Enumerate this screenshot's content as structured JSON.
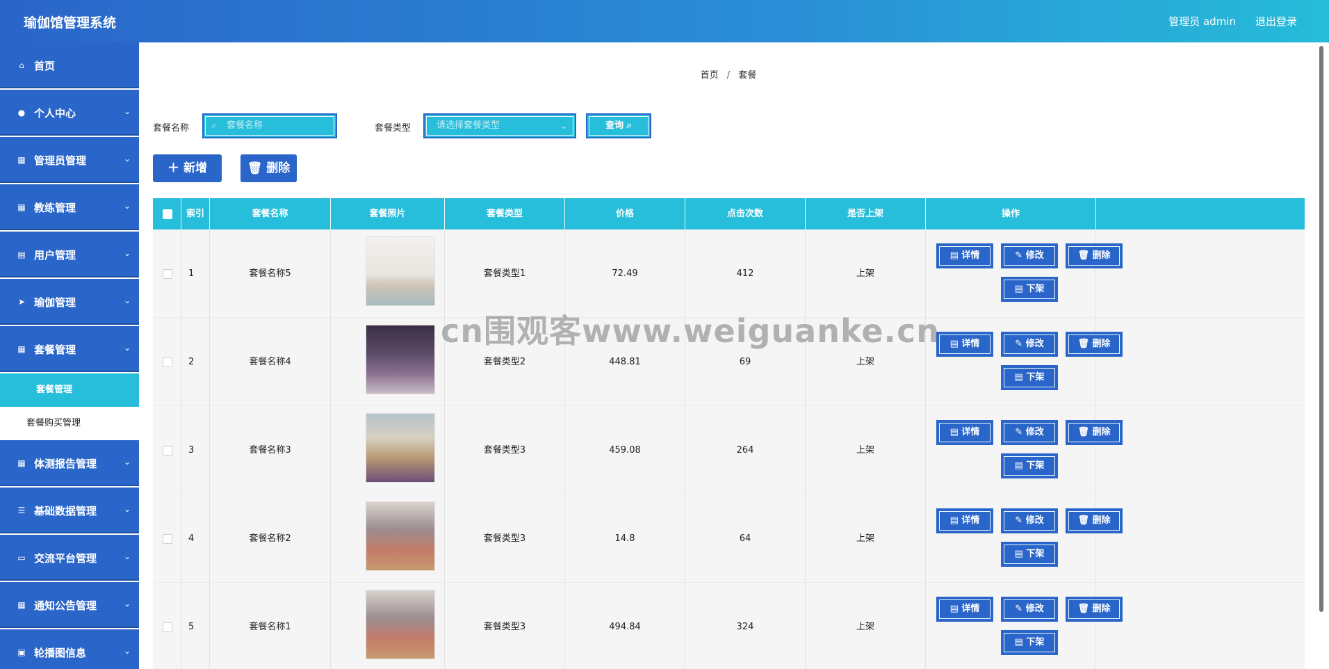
{
  "header": {
    "title": "瑜伽馆管理系统",
    "user": "管理员 admin",
    "logout": "退出登录"
  },
  "sidebar": {
    "items": [
      {
        "label": "首页",
        "icon": "home-icon",
        "glyph": "⌂",
        "arrow": ""
      },
      {
        "label": "个人中心",
        "icon": "user-icon",
        "glyph": "●",
        "arrow": "⌄"
      },
      {
        "label": "管理员管理",
        "icon": "grid-icon",
        "glyph": "▦",
        "arrow": "⌄"
      },
      {
        "label": "教练管理",
        "icon": "grid-icon",
        "glyph": "▦",
        "arrow": "⌄"
      },
      {
        "label": "用户管理",
        "icon": "document-icon",
        "glyph": "▤",
        "arrow": "⌄"
      },
      {
        "label": "瑜伽管理",
        "icon": "send-icon",
        "glyph": "➤",
        "arrow": "⌄"
      },
      {
        "label": "套餐管理",
        "icon": "grid-icon",
        "glyph": "▦",
        "arrow": "⌄"
      }
    ],
    "sub_items": [
      {
        "label": "套餐管理"
      },
      {
        "label": "套餐购买管理"
      }
    ],
    "items_after": [
      {
        "label": "体测报告管理",
        "icon": "grid-icon",
        "glyph": "▦",
        "arrow": "⌄"
      },
      {
        "label": "基础数据管理",
        "icon": "sliders-icon",
        "glyph": "☰",
        "arrow": "⌄"
      },
      {
        "label": "交流平台管理",
        "icon": "monitor-icon",
        "glyph": "▭",
        "arrow": "⌄"
      },
      {
        "label": "通知公告管理",
        "icon": "grid-icon",
        "glyph": "▦",
        "arrow": "⌄"
      },
      {
        "label": "轮播图信息",
        "icon": "clipboard-icon",
        "glyph": "▣",
        "arrow": "⌄"
      }
    ]
  },
  "breadcrumb": {
    "home": "首页",
    "sep": "/",
    "current": "套餐"
  },
  "search": {
    "name_label": "套餐名称",
    "name_placeholder": "套餐名称",
    "type_label": "套餐类型",
    "type_placeholder": "请选择套餐类型",
    "button": "查询 ⌕"
  },
  "actions": {
    "add": "＋ 新增",
    "delete": "🗑 删除"
  },
  "table": {
    "columns": [
      "索引",
      "套餐名称",
      "套餐照片",
      "套餐类型",
      "价格",
      "点击次数",
      "是否上架",
      "操作"
    ],
    "rows": [
      {
        "index": "1",
        "name": "套餐名称5",
        "type": "套餐类型1",
        "price": "72.49",
        "clicks": "412",
        "status": "上架"
      },
      {
        "index": "2",
        "name": "套餐名称4",
        "type": "套餐类型2",
        "price": "448.81",
        "clicks": "69",
        "status": "上架"
      },
      {
        "index": "3",
        "name": "套餐名称3",
        "type": "套餐类型3",
        "price": "459.08",
        "clicks": "264",
        "status": "上架"
      },
      {
        "index": "4",
        "name": "套餐名称2",
        "type": "套餐类型3",
        "price": "14.8",
        "clicks": "64",
        "status": "上架"
      },
      {
        "index": "5",
        "name": "套餐名称1",
        "type": "套餐类型3",
        "price": "494.84",
        "clicks": "324",
        "status": "上架"
      }
    ],
    "op_buttons": {
      "detail": "▤ 详情",
      "edit": "✎ 修改",
      "delete": "🗑 删除",
      "offshelf": "▤ 下架"
    }
  },
  "watermark": "cn围观客www.weiguanke.cn",
  "colors": {
    "primary": "#2a65c9",
    "accent": "#27bedb"
  }
}
